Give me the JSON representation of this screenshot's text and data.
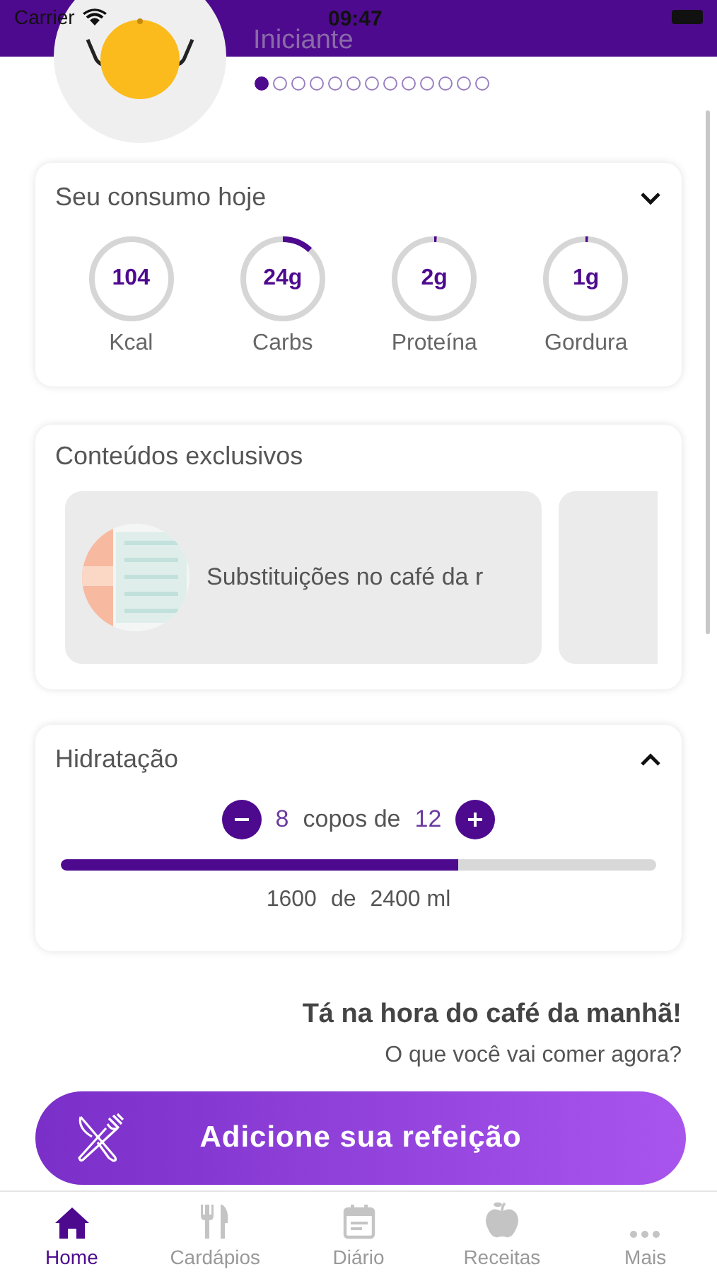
{
  "status_bar": {
    "carrier": "Carrier",
    "time": "09:47"
  },
  "profile": {
    "level_name": "Iniciante",
    "steps": [
      {
        "selected": true
      },
      {
        "selected": false
      },
      {
        "selected": false
      },
      {
        "selected": false
      },
      {
        "selected": false
      },
      {
        "selected": false
      },
      {
        "selected": false
      },
      {
        "selected": false
      },
      {
        "selected": false
      },
      {
        "selected": false
      },
      {
        "selected": false
      },
      {
        "selected": false
      },
      {
        "selected": false
      }
    ]
  },
  "consumption": {
    "title": "Seu consumo hoje",
    "expanded": false,
    "items": [
      {
        "value": "104",
        "label": "Kcal"
      },
      {
        "value": "24g",
        "label": "Carbs",
        "level": 0.12
      },
      {
        "value": "2g",
        "label": "Proteína",
        "level": 0.01
      },
      {
        "value": "1g",
        "label": "Gordura",
        "level": 0.01
      }
    ]
  },
  "exclusive": {
    "title": "Conteúdos exclusivos",
    "cards": [
      {
        "kind": "article",
        "title": "Substituições no café da r"
      },
      {
        "kind": "empty"
      }
    ]
  },
  "hydration": {
    "title": "Hidratação",
    "expanded": true,
    "cups": "8",
    "cups_label": "copos de",
    "cups_goal": "12",
    "level": 0.667,
    "amount": "1600",
    "amount_sep": "de",
    "goal": "2400 ml"
  },
  "meal_prompt": {
    "title": "Tá na hora do café da manhã!",
    "subtitle": "O que você vai comer agora?",
    "button": "Adicione sua refeição"
  },
  "tab_bar": [
    {
      "label": "Home",
      "selected": true
    },
    {
      "label": "Cardápios",
      "selected": false
    },
    {
      "label": "Diário",
      "selected": false
    },
    {
      "label": "Receitas",
      "selected": false
    },
    {
      "label": "Mais",
      "selected": false
    }
  ]
}
